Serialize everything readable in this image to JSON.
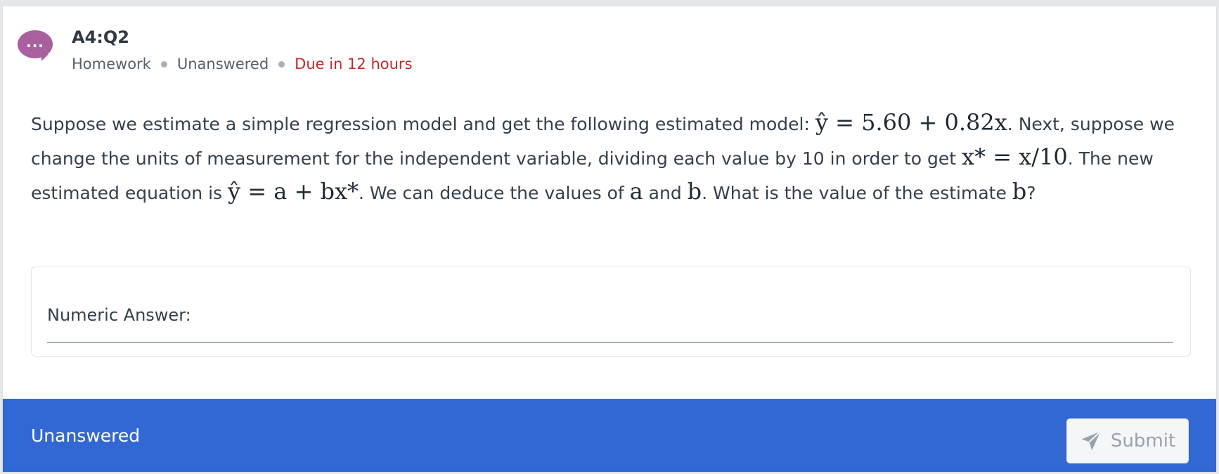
{
  "header": {
    "avatar_icon": "speech-bubble-ellipsis-icon",
    "avatar_text": "...",
    "title": "A4:Q2",
    "meta": {
      "type": "Homework",
      "status": "Unanswered",
      "due": "Due in 12 hours"
    }
  },
  "question": {
    "p1": "Suppose we estimate a simple regression model and get the following estimated model: ",
    "m1": "ŷ = 5.60 + 0.82x",
    "p2": ". Next, suppose we change the units of measurement for the independent variable, dividing each value by 10 in order to get ",
    "m2": "x* = x/10",
    "p3": ". The new estimated equation is ",
    "m3": "ŷ = a + bx*",
    "p4": ". We can deduce the values of ",
    "m4": "a",
    "p5": " and ",
    "m5": "b",
    "p6": ". What is the value of the estimate ",
    "m6": "b",
    "p7": "?"
  },
  "answer": {
    "label": "Numeric Answer:",
    "value": ""
  },
  "footer": {
    "status": "Unanswered",
    "submit_label": "Submit",
    "submit_icon": "paper-plane-icon"
  },
  "colors": {
    "accent": "#3268d4",
    "avatar": "#a8609f",
    "due": "#c62828"
  }
}
